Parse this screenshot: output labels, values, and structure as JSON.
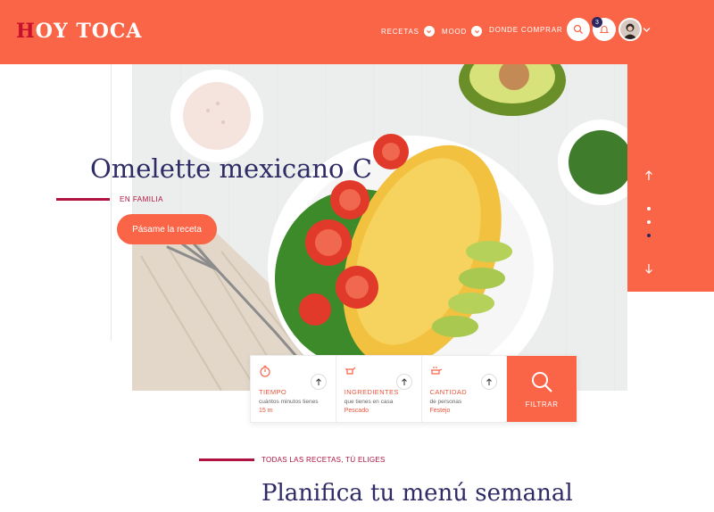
{
  "brand": {
    "logo_first": "H",
    "logo_rest": "OY TOCA"
  },
  "nav": {
    "recetas": "RECETAS",
    "mood": "MOOD",
    "donde_comprar": "DONDE COMPRAR",
    "notifications_count": "3"
  },
  "hero": {
    "title": "Omelette mexicano C",
    "tag": "EN FAMILIA",
    "cta": "Pásame la receta"
  },
  "filters": [
    {
      "icon": "stopwatch-icon",
      "label": "TIEMPO",
      "sub": "cuántos minutos tienes",
      "value": "15 m"
    },
    {
      "icon": "ingredients-icon",
      "label": "INGREDIENTES",
      "sub": "que tienes en casa",
      "value": "Pescado"
    },
    {
      "icon": "servings-icon",
      "label": "CANTIDAD",
      "sub": "de personas",
      "value": "Festejo"
    }
  ],
  "filter_button": "FILTRAR",
  "section": {
    "tag": "TODAS LAS RECETAS, TÚ ELIGES",
    "title": "Planifica tu menú semanal"
  },
  "colors": {
    "accent": "#fa6447",
    "navy": "#2f2b66",
    "crimson": "#b2123f"
  }
}
